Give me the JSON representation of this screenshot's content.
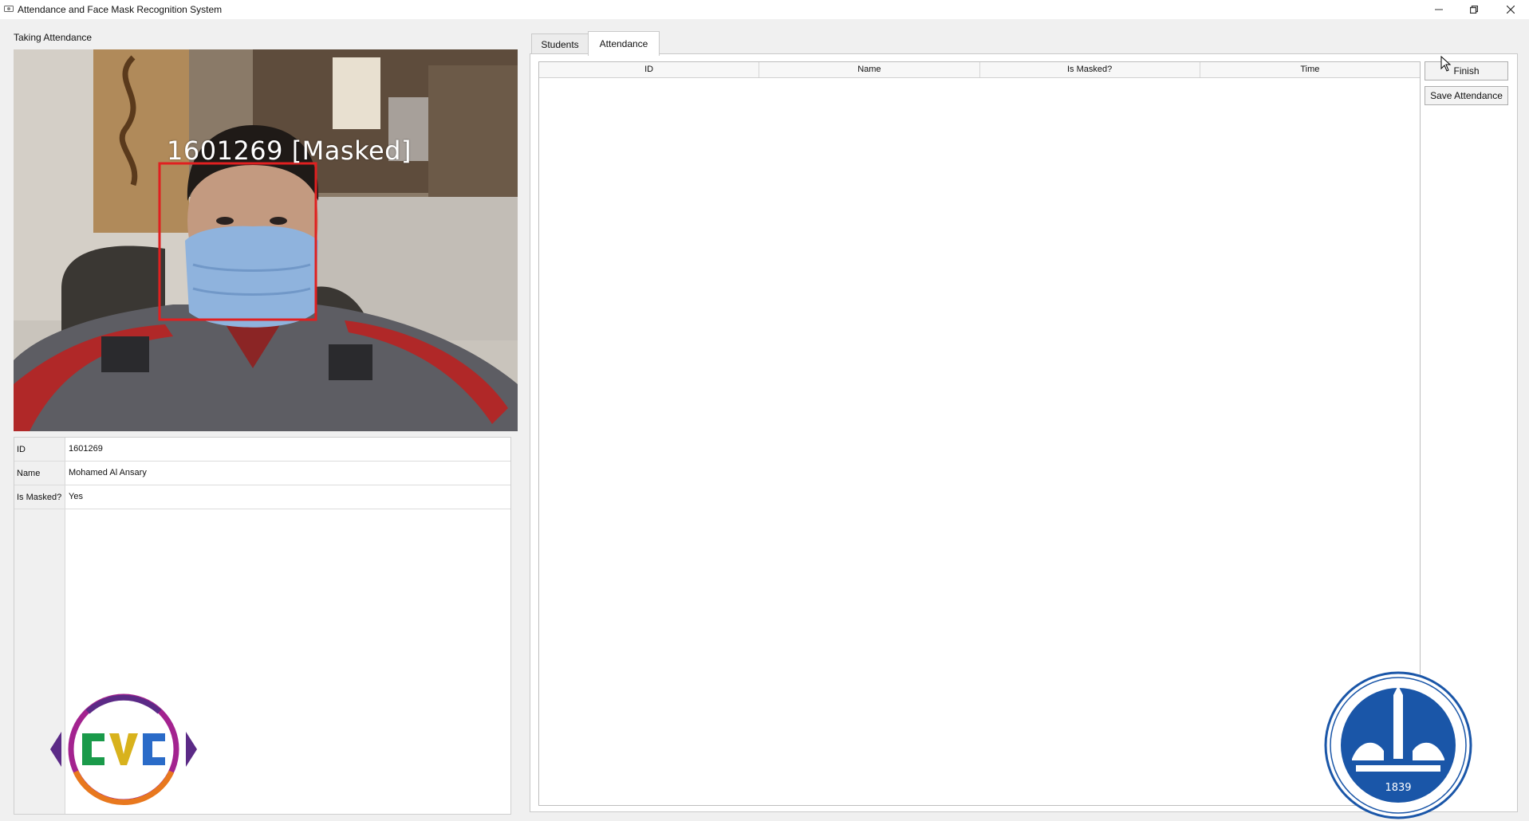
{
  "window": {
    "title": "Attendance and Face Mask Recognition System",
    "controls": [
      "minimize-icon",
      "restore-icon",
      "close-icon"
    ]
  },
  "left_panel": {
    "group_label": "Taking Attendance",
    "camera": {
      "overlay_label": "1601269 [Masked]",
      "box_color": "#e02020"
    },
    "info": [
      {
        "key": "ID",
        "value": "1601269"
      },
      {
        "key": "Name",
        "value": "Mohamed Al Ansary"
      },
      {
        "key": "Is Masked?",
        "value": "Yes"
      }
    ]
  },
  "tabs": [
    {
      "label": "Students",
      "active": false
    },
    {
      "label": "Attendance",
      "active": true
    }
  ],
  "attendance_table": {
    "columns": [
      "ID",
      "Name",
      "Is Masked?",
      "Time"
    ],
    "rows": []
  },
  "buttons": {
    "finish": "Finish",
    "save": "Save Attendance"
  },
  "logos": {
    "left": "cvc-logo",
    "right": "university-seal",
    "seal_year": "1839"
  },
  "colors": {
    "window_bg": "#f0f0f0",
    "detection_box": "#e02020",
    "seal_blue": "#1a56a8"
  }
}
